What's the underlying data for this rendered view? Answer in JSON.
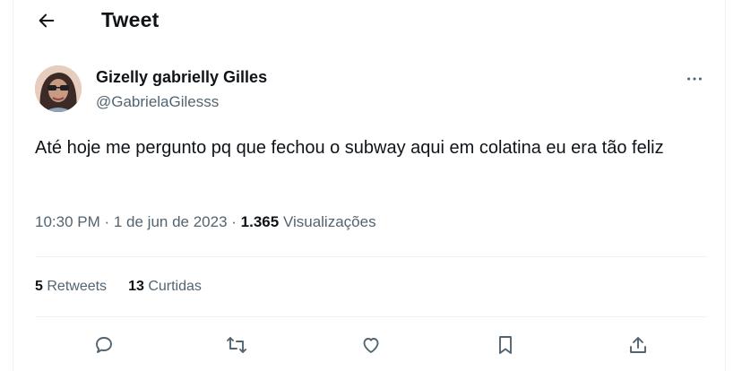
{
  "header": {
    "title": "Tweet",
    "back_icon": "arrow-left-icon"
  },
  "author": {
    "name": "Gizelly gabrielly Gilles",
    "handle": "@GabrielaGilesss",
    "more_icon": "more-horizontal-icon"
  },
  "tweet": {
    "text": "Até hoje me pergunto pq que fechou o subway aqui em colatina eu era tão feliz",
    "time": "10:30 PM",
    "date": "1 de jun de 2023",
    "views_count": "1.365",
    "views_label": "Visualizações"
  },
  "stats": {
    "retweets_count": "5",
    "retweets_label": "Retweets",
    "likes_count": "13",
    "likes_label": "Curtidas"
  },
  "actions": [
    "reply-icon",
    "retweet-icon",
    "like-icon",
    "bookmark-icon",
    "share-icon"
  ],
  "colors": {
    "text": "#0f1419",
    "secondary": "#536471",
    "divider": "#eff3f4"
  }
}
